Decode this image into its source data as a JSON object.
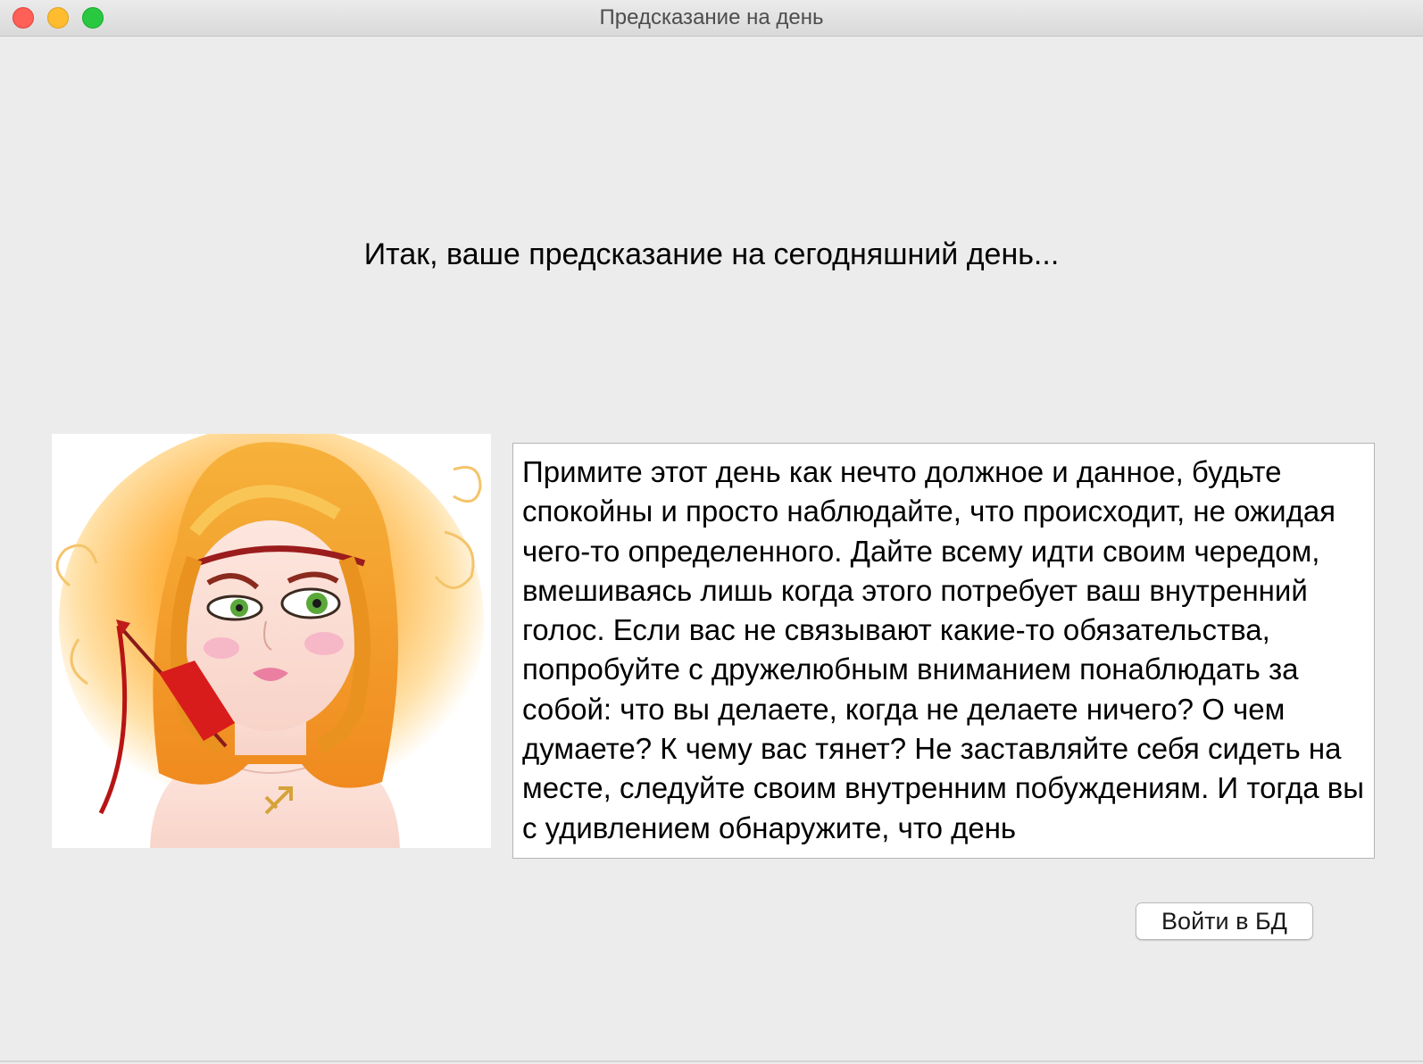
{
  "window": {
    "title": "Предсказание на день"
  },
  "heading": "Итак, ваше предсказание на сегодняшний день...",
  "portrait": {
    "icon": "sagittarius-zodiac-girl-illustration"
  },
  "prediction": {
    "text": "Примите этот день как нечто должное и данное, будьте спокойны и просто наблюдайте, что происходит, не ожидая чего-то определенного. Дайте всему идти своим чередом, вмешиваясь лишь когда этого потребует ваш внутренний голос. Если вас не связывают какие-то обязательства, попробуйте с дружелюбным вниманием понаблюдать за собой: что вы делаете, когда не делаете ничего? О чем думаете? К чему вас тянет? Не заставляйте себя сидеть на месте, следуйте своим внутренним побуждениям. И тогда вы с удивлением обнаружите, что день"
  },
  "buttons": {
    "db_login": "Войти в БД"
  },
  "colors": {
    "close": "#fe5f57",
    "minimize": "#febc2e",
    "zoom": "#28c840"
  }
}
